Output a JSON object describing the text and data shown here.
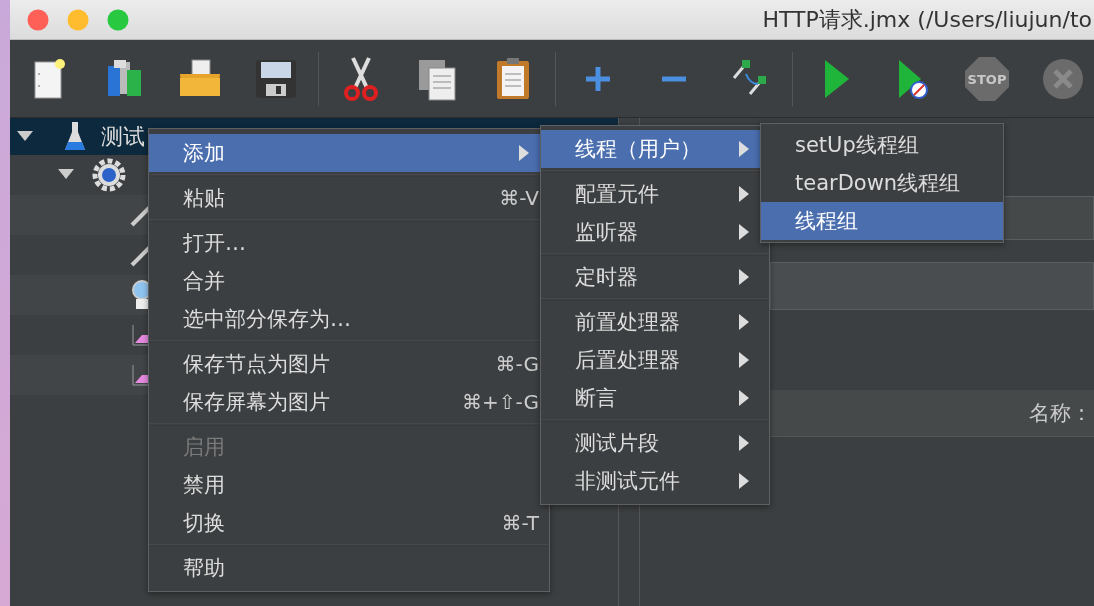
{
  "window": {
    "title": "HTTP请求.jmx (/Users/liujun/to"
  },
  "toolbar": {
    "stop_label": "STOP"
  },
  "tree": [
    {
      "label": "测试",
      "selected": true,
      "expanded": true,
      "children": [
        {
          "selected": false,
          "expanded": true,
          "children": [
            {
              "kind": "pencil",
              "selected": false
            },
            {
              "kind": "pencil",
              "selected": false
            },
            {
              "kind": "magnifier",
              "selected": false
            },
            {
              "kind": "graph",
              "selected": false
            },
            {
              "kind": "graph",
              "selected": false
            }
          ]
        }
      ]
    }
  ],
  "form": {
    "name_label": "名称："
  },
  "context_menu": {
    "groups": [
      [
        {
          "label": "添加",
          "selected": true,
          "disabled": false,
          "submenu": true
        }
      ],
      [
        {
          "label": "粘贴",
          "shortcut": "⌘-V",
          "selected": false,
          "disabled": false,
          "submenu": false
        }
      ],
      [
        {
          "label": "打开…",
          "selected": false,
          "disabled": false,
          "submenu": false
        },
        {
          "label": "合并",
          "selected": false,
          "disabled": false,
          "submenu": false
        },
        {
          "label": "选中部分保存为…",
          "selected": false,
          "disabled": false,
          "submenu": false
        }
      ],
      [
        {
          "label": "保存节点为图片",
          "shortcut": "⌘-G",
          "selected": false,
          "disabled": false,
          "submenu": false
        },
        {
          "label": "保存屏幕为图片",
          "shortcut": "⌘+⇧-G",
          "selected": false,
          "disabled": false,
          "submenu": false
        }
      ],
      [
        {
          "label": "启用",
          "selected": false,
          "disabled": true,
          "submenu": false
        },
        {
          "label": "禁用",
          "selected": false,
          "disabled": false,
          "submenu": false
        },
        {
          "label": "切换",
          "shortcut": "⌘-T",
          "selected": false,
          "disabled": false,
          "submenu": false
        }
      ],
      [
        {
          "label": "帮助",
          "selected": false,
          "disabled": false,
          "submenu": false
        }
      ]
    ]
  },
  "add_submenu": {
    "groups": [
      [
        {
          "label": "线程（用户）",
          "selected": true,
          "disabled": false,
          "submenu": true
        }
      ],
      [
        {
          "label": "配置元件",
          "selected": false,
          "disabled": false,
          "submenu": true
        },
        {
          "label": "监听器",
          "selected": false,
          "disabled": false,
          "submenu": true
        }
      ],
      [
        {
          "label": "定时器",
          "selected": false,
          "disabled": false,
          "submenu": true
        }
      ],
      [
        {
          "label": "前置处理器",
          "selected": false,
          "disabled": false,
          "submenu": true
        },
        {
          "label": "后置处理器",
          "selected": false,
          "disabled": false,
          "submenu": true
        },
        {
          "label": "断言",
          "selected": false,
          "disabled": false,
          "submenu": true
        }
      ],
      [
        {
          "label": "测试片段",
          "selected": false,
          "disabled": false,
          "submenu": true
        },
        {
          "label": "非测试元件",
          "selected": false,
          "disabled": false,
          "submenu": true
        }
      ]
    ]
  },
  "threads_submenu": {
    "groups": [
      [
        {
          "label": "setUp线程组",
          "selected": false,
          "disabled": false,
          "submenu": false
        },
        {
          "label": "tearDown线程组",
          "selected": false,
          "disabled": false,
          "submenu": false
        },
        {
          "label": "线程组",
          "selected": true,
          "disabled": false,
          "submenu": false
        }
      ]
    ]
  }
}
